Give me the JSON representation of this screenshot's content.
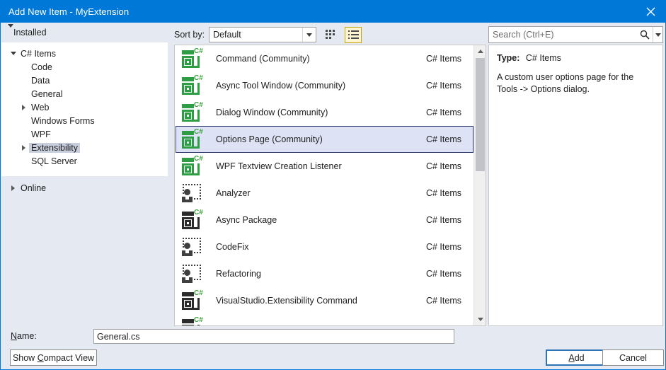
{
  "window": {
    "title": "Add New Item - MyExtension",
    "close_icon": "close-icon"
  },
  "tree": {
    "installed_label": "Installed",
    "online_label": "Online",
    "root": {
      "label": "C# Items",
      "expanded": true,
      "children": [
        {
          "label": "Code",
          "has_children": false,
          "selected": false
        },
        {
          "label": "Data",
          "has_children": false,
          "selected": false
        },
        {
          "label": "General",
          "has_children": false,
          "selected": false
        },
        {
          "label": "Web",
          "has_children": true,
          "selected": false
        },
        {
          "label": "Windows Forms",
          "has_children": false,
          "selected": false
        },
        {
          "label": "WPF",
          "has_children": false,
          "selected": false
        },
        {
          "label": "Extensibility",
          "has_children": true,
          "selected": true
        },
        {
          "label": "SQL Server",
          "has_children": false,
          "selected": false
        }
      ]
    }
  },
  "toolbar": {
    "sort_label": "Sort by:",
    "sort_value": "Default",
    "sort_options": [
      "Default"
    ],
    "grid_view_icon": "grid-view-icon",
    "list_view_icon": "list-view-icon",
    "active_view": "list",
    "active_view_border_color": "#c7a500",
    "active_view_fill_color": "#fdf4d2"
  },
  "search": {
    "placeholder": "Search (Ctrl+E)",
    "value": "",
    "search_icon": "search-icon",
    "dropdown_icon": "chevron-down-icon"
  },
  "list": {
    "selected_index": 3,
    "selection_fill": "#dde3f5",
    "selection_border": "#2f3a6e",
    "items": [
      {
        "name": "Command (Community)",
        "type": "C# Items",
        "icon": "vs-package-icon",
        "icon_color": "#2e9e45"
      },
      {
        "name": "Async Tool Window (Community)",
        "type": "C# Items",
        "icon": "vs-package-icon",
        "icon_color": "#2e9e45"
      },
      {
        "name": "Dialog Window (Community)",
        "type": "C# Items",
        "icon": "vs-package-icon",
        "icon_color": "#2e9e45"
      },
      {
        "name": "Options Page (Community)",
        "type": "C# Items",
        "icon": "vs-package-icon",
        "icon_color": "#2e9e45"
      },
      {
        "name": "WPF Textview Creation Listener",
        "type": "C# Items",
        "icon": "vs-package-icon",
        "icon_color": "#2e9e45"
      },
      {
        "name": "Analyzer",
        "type": "C# Items",
        "icon": "analyzer-icon",
        "icon_color": "#3f3f3f"
      },
      {
        "name": "Async Package",
        "type": "C# Items",
        "icon": "vs-package-icon",
        "icon_color": "#2b2b2b"
      },
      {
        "name": "CodeFix",
        "type": "C# Items",
        "icon": "analyzer-icon",
        "icon_color": "#3f3f3f"
      },
      {
        "name": "Refactoring",
        "type": "C# Items",
        "icon": "analyzer-icon",
        "icon_color": "#3f3f3f"
      },
      {
        "name": "VisualStudio.Extensibility Command",
        "type": "C# Items",
        "icon": "vs-package-icon",
        "icon_color": "#2b2b2b"
      },
      {
        "name": "",
        "type": "",
        "icon": "vs-package-icon",
        "icon_color": "#2b2b2b"
      }
    ]
  },
  "details": {
    "type_label": "Type:",
    "type_value": "C# Items",
    "description": "A custom user options page for the Tools -> Options dialog."
  },
  "footer": {
    "name_label": "Name:",
    "name_accel": "N",
    "name_value": "General.cs",
    "compact_button": "Show Compact View",
    "compact_accel": "C",
    "add_button": "Add",
    "add_accel": "A",
    "cancel_button": "Cancel"
  }
}
